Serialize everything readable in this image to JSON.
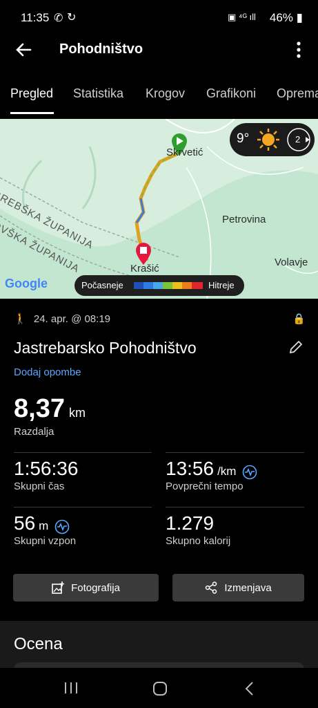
{
  "status_bar": {
    "time": "11:35",
    "battery": "46%"
  },
  "header": {
    "title": "Pohodništvo"
  },
  "tabs": [
    "Pregled",
    "Statistika",
    "Krogov",
    "Grafikoni",
    "Oprema"
  ],
  "map": {
    "places": {
      "skrvetic": "Skrvetić",
      "petrovina": "Petrovina",
      "krasic": "Krašić",
      "volavje": "Volavje",
      "county1": "GREBŠKA ŽUPANIJA",
      "county2": "OVŠKA ŽUPANIJA"
    },
    "weather": {
      "temp": "9°",
      "wind": "2"
    },
    "legend": {
      "slower": "Počasneje",
      "faster": "Hitreje"
    },
    "attribution": "Google",
    "colors": {
      "route_start": "#2e9e2e",
      "route_end": "#e5173f"
    }
  },
  "activity": {
    "date": "24. apr. @ 08:19",
    "name": "Jastrebarsko Pohodništvo",
    "add_note": "Dodaj opombe",
    "distance": {
      "value": "8,37",
      "unit": "km",
      "label": "Razdalja"
    },
    "stats": [
      {
        "value": "1:56:36",
        "unit": "",
        "label": "Skupni čas"
      },
      {
        "value": "13:56",
        "unit": "/km",
        "label": "Povprečni tempo"
      },
      {
        "value": "56",
        "unit": "m",
        "label": "Skupni vzpon"
      },
      {
        "value": "1.279",
        "unit": "",
        "label": "Skupno kalorij"
      }
    ]
  },
  "actions": {
    "photo": "Fotografija",
    "share": "Izmenjava"
  },
  "rating": {
    "title": "Ocena"
  }
}
